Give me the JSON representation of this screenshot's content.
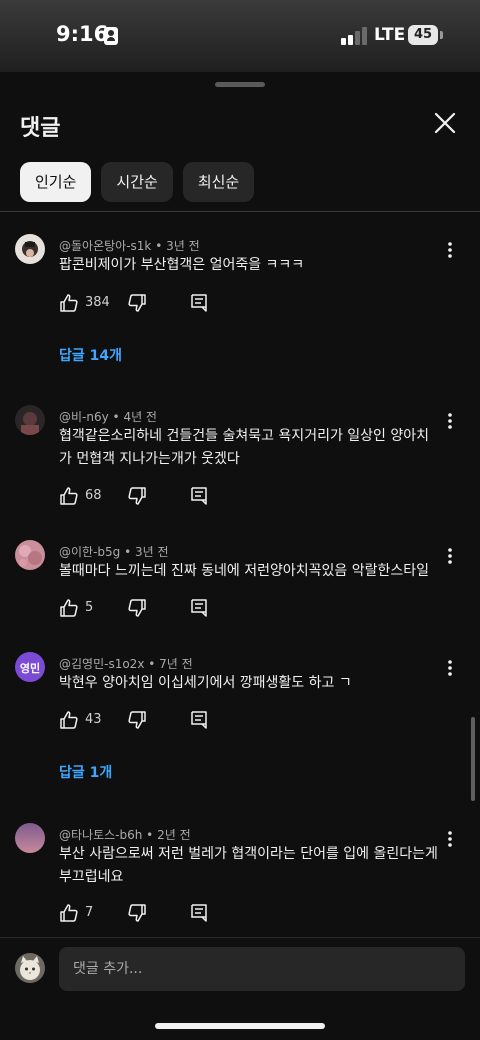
{
  "status_bar": {
    "time": "9:16",
    "network": "LTE",
    "battery": "45"
  },
  "sheet": {
    "title": "댓글",
    "sort_chips": [
      {
        "label": "인기순",
        "active": true
      },
      {
        "label": "시간순",
        "active": false
      },
      {
        "label": "최신순",
        "active": false
      }
    ]
  },
  "comments": [
    {
      "author": "@돌아온탕아-s1k",
      "time": "3년 전",
      "text": "팝콘비제이가 부산협객은 얼어죽을 ㅋㅋㅋ",
      "likes": "384",
      "replies": "답글 14개"
    },
    {
      "author": "@비-n6y",
      "time": "4년 전",
      "text": "협객같은소리하네 건들건들 술쳐묵고 욕지거리가 일상인 양아치가 먼협객  지나가는개가 웃겠다",
      "likes": "68",
      "replies": ""
    },
    {
      "author": "@이한-b5g",
      "time": "3년 전",
      "text": "볼때마다 느끼는데 진짜 동네에 저런양아치꼭있음 악랄한스타일",
      "likes": "5",
      "replies": ""
    },
    {
      "author": "@김영민-s1o2x",
      "time": "7년 전",
      "text": "박현우 양아치임 이십세기에서 깡패생활도 하고 ㄱ",
      "likes": "43",
      "replies": "답글 1개",
      "avatar_text": "영민"
    },
    {
      "author": "@타나토스-b6h",
      "time": "2년 전",
      "text": "부산 사람으로써 저런 벌레가 협객이라는 단어를 입에 올린다는게 부끄럽네요",
      "likes": "7",
      "replies": ""
    }
  ],
  "composer": {
    "placeholder": "댓글 추가..."
  },
  "colors": {
    "background": "#0f0f0f",
    "chip_bg": "#272727",
    "link_blue": "#3ea6ff",
    "muted_text": "#aaaaaa"
  }
}
